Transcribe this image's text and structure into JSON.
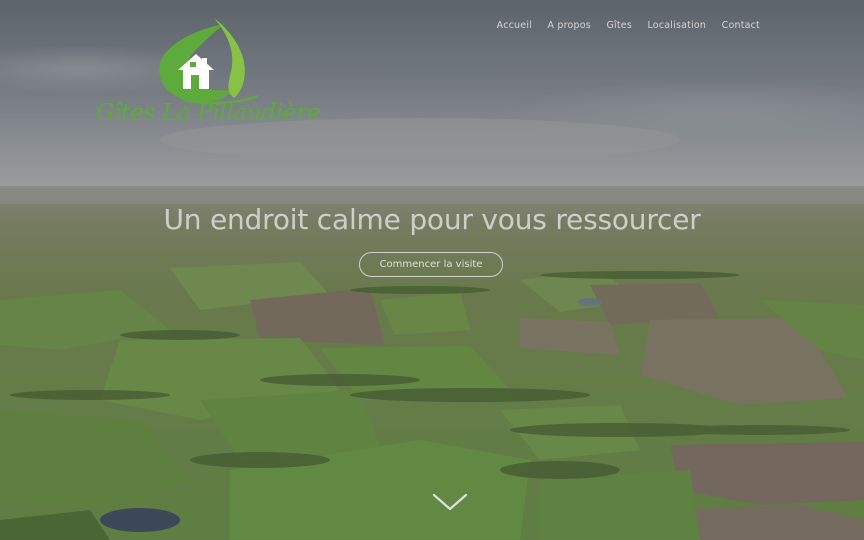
{
  "site": {
    "logo_text": "Gîtes La Pillaudière",
    "brand_color": "#5faa3c",
    "brand_light": "#88c244"
  },
  "nav": {
    "items": [
      {
        "label": "Accueil"
      },
      {
        "label": "A propos"
      },
      {
        "label": "Gîtes"
      },
      {
        "label": "Localisation"
      },
      {
        "label": "Contact"
      }
    ]
  },
  "hero": {
    "headline": "Un endroit calme pour vous ressourcer",
    "cta_label": "Commencer la visite",
    "scroll_icon": "chevron-down-icon",
    "background": "aerial view of green countryside fields"
  }
}
